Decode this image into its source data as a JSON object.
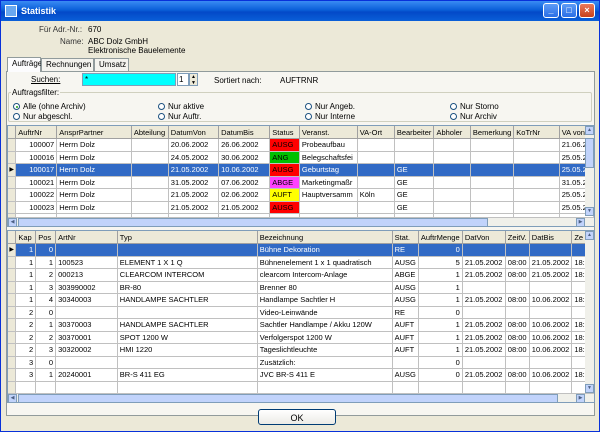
{
  "window": {
    "title": "Statistik"
  },
  "header": {
    "adr_label": "Für Adr.-Nr.:",
    "adr_value": "670",
    "name_label": "Name:",
    "name_line1": "ABC Dolz GmbH",
    "name_line2": "Elektronische Bauelemente"
  },
  "tabs": [
    "Aufträge",
    "Rechnungen",
    "Umsatz"
  ],
  "search": {
    "label": "Suchen:",
    "value": "*",
    "spin_value": "1",
    "sort_label": "Sortiert nach:",
    "sort_value": "AUFTRNR"
  },
  "filter": {
    "title": "Auftragsfilter:",
    "options": [
      {
        "label": "Alle (ohne Archiv)",
        "selected": true
      },
      {
        "label": "Nur abgeschl.",
        "selected": false
      },
      {
        "label": "Nur aktive",
        "selected": false
      },
      {
        "label": "Nur Auftr.",
        "selected": false
      },
      {
        "label": "Nur Angeb.",
        "selected": false
      },
      {
        "label": "Nur Interne",
        "selected": false
      },
      {
        "label": "Nur Storno",
        "selected": false
      },
      {
        "label": "Nur Archiv",
        "selected": false
      }
    ]
  },
  "orders": {
    "columns": [
      "AuftrNr",
      "AnsprPartner",
      "Abteilung",
      "DatumVon",
      "DatumBis",
      "Status",
      "Veranst.",
      "VA-Ort",
      "Bearbeiter",
      "Abholer",
      "Bemerkung",
      "KoTrNr",
      "VA von"
    ],
    "rows": [
      {
        "cells": [
          "100007",
          "Herrn Dolz",
          "",
          "20.06.2002",
          "26.06.2002",
          "AUSG",
          "Probeaufbau",
          "",
          "",
          "",
          "",
          "",
          "21.06.20"
        ],
        "status_color": "#ff0000",
        "selected": false
      },
      {
        "cells": [
          "100016",
          "Herrn Dolz",
          "",
          "24.05.2002",
          "30.06.2002",
          "ANG",
          "Belegschaftsfei",
          "",
          "",
          "",
          "",
          "",
          "25.05.20"
        ],
        "status_color": "#00c000",
        "selected": false
      },
      {
        "cells": [
          "100017",
          "Herrn Dolz",
          "",
          "21.05.2002",
          "10.06.2002",
          "AUSG",
          "Geburtstag",
          "",
          "GE",
          "",
          "",
          "",
          "25.05.20"
        ],
        "status_color": "#ff0000",
        "selected": true
      },
      {
        "cells": [
          "100021",
          "Herrn Dolz",
          "",
          "31.05.2002",
          "07.06.2002",
          "ABGE",
          "Marketingmaßr",
          "",
          "GE",
          "",
          "",
          "",
          "31.05.20"
        ],
        "status_color": "#ff40ff",
        "selected": false
      },
      {
        "cells": [
          "100022",
          "Herrn Dolz",
          "",
          "21.05.2002",
          "02.06.2002",
          "AUFT",
          "Hauptversamm",
          "Köln",
          "GE",
          "",
          "",
          "",
          "25.05.20"
        ],
        "status_color": "#ffff00",
        "selected": false
      },
      {
        "cells": [
          "100023",
          "Herrn Dolz",
          "",
          "21.05.2002",
          "21.05.2002",
          "AUSG",
          "",
          "",
          "GE",
          "",
          "",
          "",
          "25.05.20"
        ],
        "status_color": "#ff0000",
        "selected": false
      }
    ]
  },
  "items": {
    "columns": [
      "Kap",
      "Pos",
      "ArtNr",
      "Typ",
      "Bezeichnung",
      "Stat.",
      "AuftrMenge",
      "DatVon",
      "ZeitV.",
      "DatBis",
      "Ze"
    ],
    "rows": [
      {
        "cells": [
          "1",
          "0",
          "",
          "",
          "Bühne Dekoration",
          "RE",
          "0",
          "",
          "",
          "",
          ""
        ],
        "selected": true
      },
      {
        "cells": [
          "1",
          "1",
          "100523",
          "ELEMENT 1 X 1 Q",
          "Bühnenelement 1 x 1 quadratisch",
          "AUSG",
          "5",
          "21.05.2002",
          "08:00",
          "21.05.2002",
          "18:"
        ],
        "selected": false
      },
      {
        "cells": [
          "1",
          "2",
          "000213",
          "CLEARCOM INTERCOM",
          "clearcom Intercom-Anlage",
          "ABGE",
          "1",
          "21.05.2002",
          "08:00",
          "21.05.2002",
          "18:"
        ],
        "selected": false
      },
      {
        "cells": [
          "1",
          "3",
          "303990002",
          "BR-80",
          "Brenner 80",
          "AUSG",
          "1",
          "",
          "",
          "",
          ""
        ],
        "selected": false
      },
      {
        "cells": [
          "1",
          "4",
          "30340003",
          "HANDLAMPE SACHTLER",
          "Handlampe Sachtler H",
          "AUSG",
          "1",
          "21.05.2002",
          "08:00",
          "10.06.2002",
          "18:"
        ],
        "selected": false
      },
      {
        "cells": [
          "2",
          "0",
          "",
          "",
          "Video-Leinwände",
          "RE",
          "0",
          "",
          "",
          "",
          ""
        ],
        "selected": false
      },
      {
        "cells": [
          "2",
          "1",
          "30370003",
          "HANDLAMPE SACHTLER",
          "Sachtler Handlampe / Akku 120W",
          "AUFT",
          "1",
          "21.05.2002",
          "08:00",
          "10.06.2002",
          "18:"
        ],
        "selected": false
      },
      {
        "cells": [
          "2",
          "2",
          "30370001",
          "SPOT 1200 W",
          "Verfolgerspot 1200 W",
          "AUFT",
          "1",
          "21.05.2002",
          "08:00",
          "10.06.2002",
          "18:"
        ],
        "selected": false
      },
      {
        "cells": [
          "2",
          "3",
          "30320002",
          "HMI 1220",
          "Tageslichtleuchte",
          "AUFT",
          "1",
          "21.05.2002",
          "08:00",
          "10.06.2002",
          "18:"
        ],
        "selected": false
      },
      {
        "cells": [
          "3",
          "0",
          "",
          "",
          "Zusätzlich:",
          "",
          "0",
          "",
          "",
          "",
          ""
        ],
        "selected": false
      },
      {
        "cells": [
          "3",
          "1",
          "20240001",
          "BR-S 411 EG",
          "JVC BR-S 411 E",
          "AUSG",
          "0",
          "21.05.2002",
          "08:00",
          "10.06.2002",
          "18:"
        ],
        "selected": false
      }
    ]
  },
  "buttons": {
    "ok": "OK"
  }
}
